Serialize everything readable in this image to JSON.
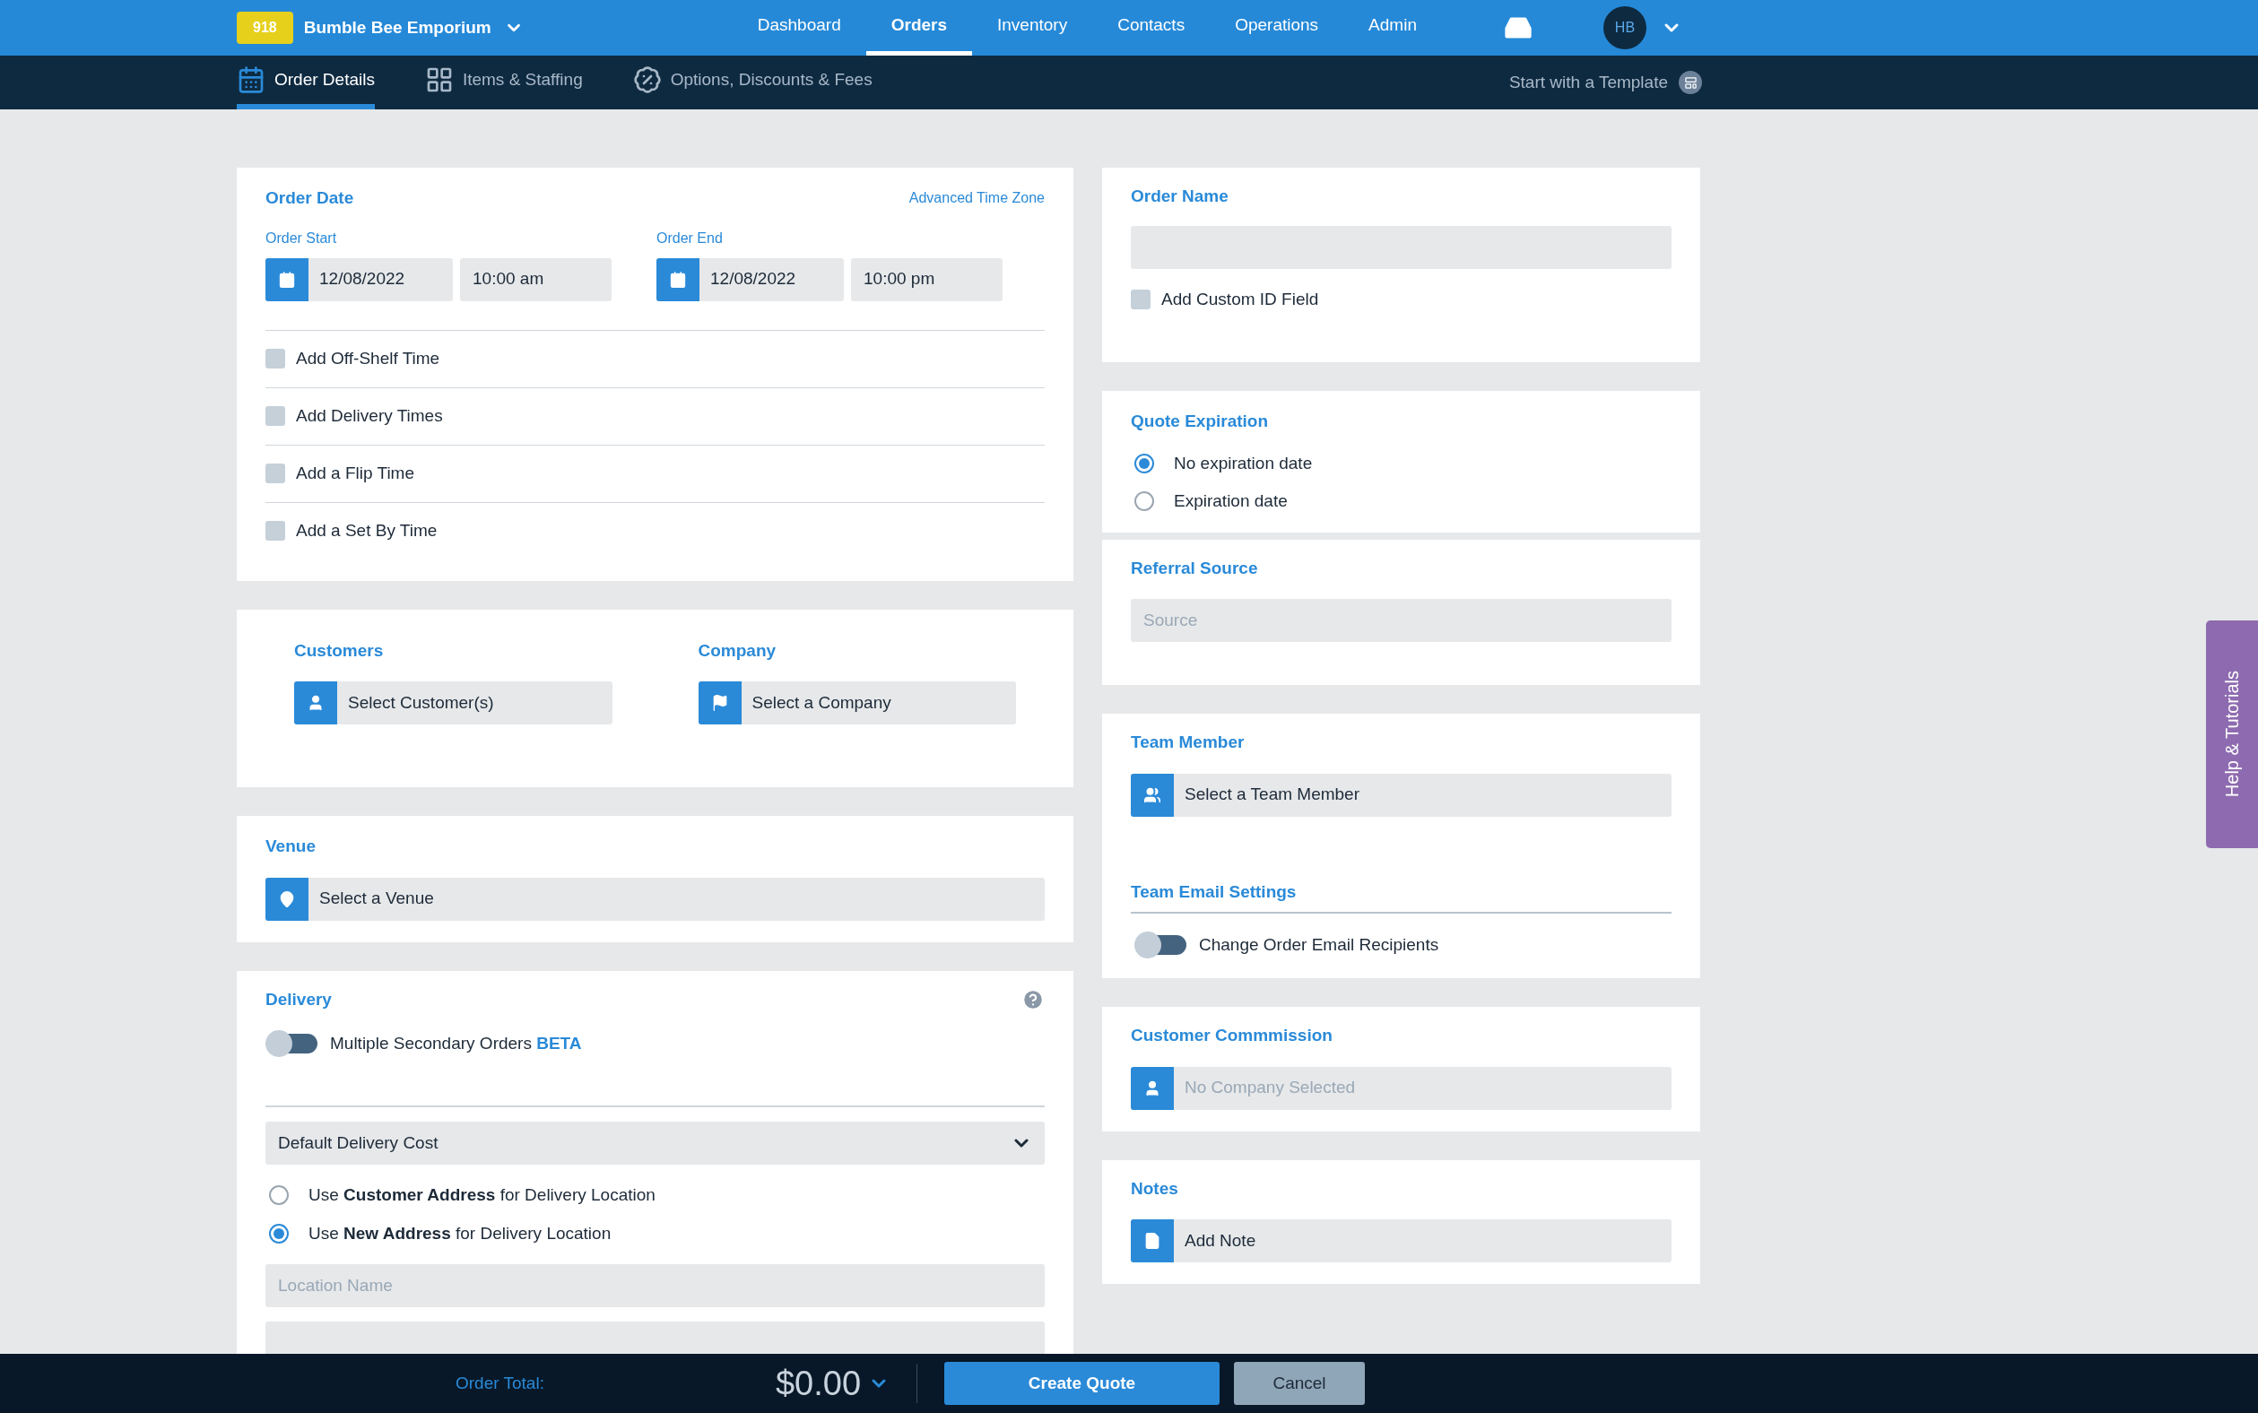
{
  "header": {
    "badge": "918",
    "company": "Bumble Bee Emporium",
    "avatar": "HB",
    "nav": [
      {
        "label": "Dashboard",
        "selected": false
      },
      {
        "label": "Orders",
        "selected": true
      },
      {
        "label": "Inventory",
        "selected": false
      },
      {
        "label": "Contacts",
        "selected": false
      },
      {
        "label": "Operations",
        "selected": false
      },
      {
        "label": "Admin",
        "selected": false
      }
    ]
  },
  "subnav": {
    "tabs": [
      {
        "label": "Order Details",
        "selected": true
      },
      {
        "label": "Items & Staffing",
        "selected": false
      },
      {
        "label": "Options, Discounts & Fees",
        "selected": false
      }
    ],
    "template": "Start with a Template"
  },
  "order_date": {
    "title": "Order Date",
    "link": "Advanced Time Zone",
    "ranges": [
      {
        "label": "Order Start",
        "date": "12/08/2022",
        "time": "10:00 am"
      },
      {
        "label": "Order End",
        "date": "12/08/2022",
        "time": "10:00 pm"
      }
    ],
    "options": [
      {
        "label": "Add Off-Shelf Time",
        "checked": false
      },
      {
        "label": "Add Delivery Times",
        "checked": false
      },
      {
        "label": "Add a Flip Time",
        "checked": false
      },
      {
        "label": "Add a Set By Time",
        "checked": false
      }
    ]
  },
  "customers": {
    "title": "Customers",
    "value": "Select Customer(s)"
  },
  "company": {
    "title": "Company",
    "value": "Select a Company"
  },
  "venue": {
    "title": "Venue",
    "value": "Select a Venue"
  },
  "delivery": {
    "title": "Delivery",
    "toggle": {
      "label": "Multiple Secondary Orders **BETA**",
      "on": false
    },
    "cost": "Default Delivery Cost",
    "address_options": [
      {
        "label": "Use **Customer Address** for Delivery Location",
        "selected": false
      },
      {
        "label": "Use **New Address** for Delivery Location",
        "selected": true
      }
    ],
    "location": {
      "placeholder": "Location Name"
    }
  },
  "order_name": {
    "title": "Order Name",
    "checkbox": {
      "label": "Add Custom ID Field",
      "checked": false
    }
  },
  "quote_expiration": {
    "title": "Quote Expiration",
    "options": [
      {
        "label": "No expiration date",
        "selected": true
      },
      {
        "label": "Expiration date",
        "selected": false
      }
    ]
  },
  "referral_source": {
    "title": "Referral Source",
    "placeholder": "Source"
  },
  "team_member": {
    "title": "Team Member",
    "value": "Select a Team Member"
  },
  "team_email": {
    "title": "Team Email Settings",
    "toggle": {
      "label": "Change Order Email Recipients",
      "on": false
    }
  },
  "commission": {
    "title": "Customer Commmission",
    "placeholder": "No Company Selected"
  },
  "notes": {
    "title": "Notes",
    "value": "Add Note"
  },
  "footer": {
    "label": "Order Total:",
    "total": "$0.00",
    "buttons": [
      {
        "label": "Create Quote",
        "kind": "primary"
      },
      {
        "label": "Cancel",
        "kind": "secondary"
      }
    ]
  },
  "help_tab": "Help & Tutorials"
}
